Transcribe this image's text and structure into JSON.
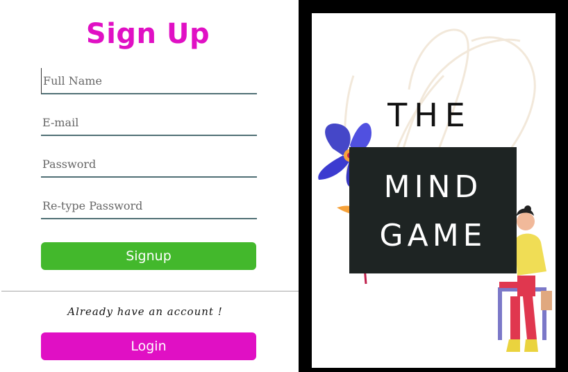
{
  "signup": {
    "title": "Sign Up",
    "fields": [
      {
        "placeholder": "Full Name"
      },
      {
        "placeholder": "E-mail"
      },
      {
        "placeholder": "Password"
      },
      {
        "placeholder": "Re-type Password"
      }
    ],
    "signup_label": "Signup",
    "already_text": "Already have an account !",
    "login_label": "Login"
  },
  "poster": {
    "line1": "THE",
    "line2": "MIND",
    "line3": "GAME"
  },
  "colors": {
    "accent": "#e010c4",
    "signup_button": "#43b82c",
    "underline": "#4f6f74",
    "poster_box": "#1e2423"
  }
}
